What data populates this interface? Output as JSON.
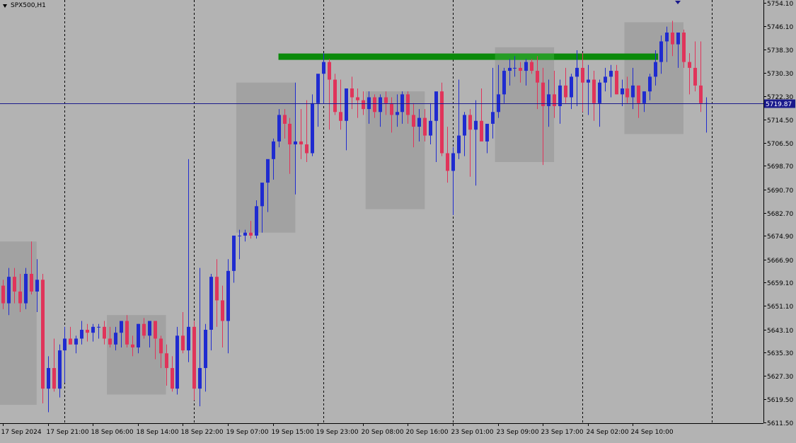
{
  "symbol": "SPX500,H1",
  "colors": {
    "background": "#b3b3b3",
    "bull": "#1f2bd0",
    "bear": "#e0345a",
    "zone": "#a2a2a2",
    "resistance": "#0a8a0a",
    "resistance_light": "#2aa02a",
    "price_line": "#1a1a8c",
    "grid": "#000000",
    "marker": "#1a1a8c"
  },
  "chart_data": {
    "type": "candlestick",
    "title": "SPX500,H1",
    "current_price": "5719.87",
    "ylim": [
      5611.5,
      5754.1
    ],
    "y_ticks": [
      "5754.10",
      "5746.10",
      "5738.30",
      "5730.30",
      "5722.30",
      "5714.50",
      "5706.50",
      "5698.70",
      "5690.70",
      "5682.70",
      "5674.90",
      "5666.90",
      "5659.10",
      "5651.10",
      "5643.10",
      "5635.30",
      "5627.30",
      "5619.50",
      "5611.50"
    ],
    "x_ticks": [
      {
        "bar": 0,
        "label": "17 Sep 2024"
      },
      {
        "bar": 8,
        "label": "17 Sep 21:00"
      },
      {
        "bar": 16,
        "label": "18 Sep 06:00"
      },
      {
        "bar": 24,
        "label": "18 Sep 14:00"
      },
      {
        "bar": 32,
        "label": "18 Sep 22:00"
      },
      {
        "bar": 40,
        "label": "19 Sep 07:00"
      },
      {
        "bar": 48,
        "label": "19 Sep 15:00"
      },
      {
        "bar": 56,
        "label": "19 Sep 23:00"
      },
      {
        "bar": 64,
        "label": "20 Sep 08:00"
      },
      {
        "bar": 72,
        "label": "20 Sep 16:00"
      },
      {
        "bar": 80,
        "label": "23 Sep 01:00"
      },
      {
        "bar": 88,
        "label": "23 Sep 09:00"
      },
      {
        "bar": 96,
        "label": "23 Sep 17:00"
      },
      {
        "bar": 104,
        "label": "24 Sep 02:00"
      },
      {
        "bar": 112,
        "label": "24 Sep 10:00"
      }
    ],
    "separators": [
      11,
      34,
      57,
      80,
      103,
      126
    ],
    "zones": [
      {
        "from": 0,
        "to": 5.5,
        "high": 5673.0,
        "low": 5617.5
      },
      {
        "from": 19,
        "to": 28.5,
        "high": 5648.0,
        "low": 5621.0
      },
      {
        "from": 42,
        "to": 51.5,
        "high": 5727.0,
        "low": 5676.0
      },
      {
        "from": 65,
        "to": 74.5,
        "high": 5724.0,
        "low": 5684.0
      },
      {
        "from": 88,
        "to": 97.5,
        "high": 5739.0,
        "low": 5700.0
      },
      {
        "from": 111,
        "to": 120.5,
        "high": 5747.5,
        "low": 5709.5
      }
    ],
    "resistance": {
      "from": 49,
      "to": 116.5,
      "value": 5735.8
    },
    "resistance_highlight": {
      "from": 88,
      "to": 97.5
    },
    "candles": [
      [
        5658,
        5660,
        5650,
        5652
      ],
      [
        5652,
        5664,
        5648,
        5661
      ],
      [
        5661,
        5664,
        5652,
        5656
      ],
      [
        5656,
        5662,
        5649,
        5652
      ],
      [
        5652,
        5664,
        5650,
        5662
      ],
      [
        5662,
        5673,
        5655,
        5656
      ],
      [
        5656,
        5667,
        5649,
        5660
      ],
      [
        5660,
        5662,
        5618,
        5623
      ],
      [
        5623,
        5634,
        5615,
        5630
      ],
      [
        5630,
        5640,
        5622,
        5623
      ],
      [
        5623,
        5638,
        5620,
        5636
      ],
      [
        5636,
        5644,
        5625,
        5640
      ],
      [
        5640,
        5644,
        5638,
        5638
      ],
      [
        5638,
        5641,
        5635,
        5640
      ],
      [
        5640,
        5646,
        5638,
        5643
      ],
      [
        5643,
        5645,
        5639,
        5642
      ],
      [
        5642,
        5645,
        5639,
        5644
      ],
      [
        5644,
        5645,
        5640,
        5644
      ],
      [
        5644,
        5646,
        5638,
        5640
      ],
      [
        5640,
        5644,
        5637,
        5638
      ],
      [
        5638,
        5644,
        5636,
        5642
      ],
      [
        5642,
        5646,
        5637,
        5646
      ],
      [
        5646,
        5648,
        5637,
        5638
      ],
      [
        5638,
        5641,
        5634,
        5637
      ],
      [
        5637,
        5645,
        5635,
        5645
      ],
      [
        5645,
        5647,
        5640,
        5641
      ],
      [
        5641,
        5646,
        5637,
        5646
      ],
      [
        5646,
        5646,
        5633,
        5640
      ],
      [
        5640,
        5641,
        5630,
        5635
      ],
      [
        5635,
        5638,
        5624,
        5630
      ],
      [
        5630,
        5634,
        5622,
        5623
      ],
      [
        5623,
        5644,
        5621,
        5641
      ],
      [
        5641,
        5649,
        5635,
        5636
      ],
      [
        5636,
        5701,
        5632,
        5644
      ],
      [
        5644,
        5646,
        5619,
        5623
      ],
      [
        5623,
        5664,
        5617,
        5630
      ],
      [
        5630,
        5645,
        5622,
        5643
      ],
      [
        5643,
        5662,
        5636,
        5661
      ],
      [
        5661,
        5667,
        5644,
        5653
      ],
      [
        5653,
        5658,
        5637,
        5646
      ],
      [
        5646,
        5667,
        5635,
        5663
      ],
      [
        5663,
        5674,
        5659,
        5675
      ],
      [
        5675,
        5677,
        5667,
        5675
      ],
      [
        5675,
        5677,
        5673,
        5676
      ],
      [
        5676,
        5680,
        5674,
        5675
      ],
      [
        5675,
        5687,
        5674,
        5685
      ],
      [
        5685,
        5690,
        5676,
        5693
      ],
      [
        5693,
        5698,
        5683,
        5701
      ],
      [
        5701,
        5708,
        5694,
        5707
      ],
      [
        5707,
        5718,
        5705,
        5716
      ],
      [
        5716,
        5718,
        5708,
        5713
      ],
      [
        5713,
        5715,
        5696,
        5706
      ],
      [
        5706,
        5727,
        5689,
        5707
      ],
      [
        5707,
        5718,
        5701,
        5706
      ],
      [
        5706,
        5721,
        5700,
        5703
      ],
      [
        5703,
        5723,
        5702,
        5720
      ],
      [
        5720,
        5727,
        5712,
        5730
      ],
      [
        5730,
        5737,
        5720,
        5734
      ],
      [
        5734,
        5735,
        5711,
        5728
      ],
      [
        5728,
        5730,
        5716,
        5717
      ],
      [
        5717,
        5728,
        5711,
        5714
      ],
      [
        5714,
        5722,
        5704,
        5725
      ],
      [
        5725,
        5729,
        5718,
        5722
      ],
      [
        5722,
        5725,
        5715,
        5721
      ],
      [
        5721,
        5724,
        5716,
        5718
      ],
      [
        5718,
        5724,
        5713,
        5722
      ],
      [
        5722,
        5723,
        5715,
        5717
      ],
      [
        5717,
        5723,
        5712,
        5722
      ],
      [
        5722,
        5724,
        5716,
        5720
      ],
      [
        5720,
        5722,
        5710,
        5716
      ],
      [
        5716,
        5723,
        5712,
        5717
      ],
      [
        5717,
        5724,
        5713,
        5723
      ],
      [
        5723,
        5724,
        5713,
        5716
      ],
      [
        5716,
        5720,
        5705,
        5712
      ],
      [
        5712,
        5718,
        5707,
        5715
      ],
      [
        5715,
        5718,
        5707,
        5709
      ],
      [
        5709,
        5720,
        5706,
        5714
      ],
      [
        5714,
        5723,
        5700,
        5724
      ],
      [
        5724,
        5727,
        5702,
        5703
      ],
      [
        5703,
        5712,
        5693,
        5697
      ],
      [
        5697,
        5705,
        5682,
        5703
      ],
      [
        5703,
        5728,
        5701,
        5709
      ],
      [
        5709,
        5717,
        5702,
        5716
      ],
      [
        5716,
        5718,
        5695,
        5711
      ],
      [
        5711,
        5721,
        5692,
        5714
      ],
      [
        5714,
        5725,
        5708,
        5707
      ],
      [
        5707,
        5710,
        5703,
        5713
      ],
      [
        5713,
        5732,
        5708,
        5717
      ],
      [
        5717,
        5733,
        5715,
        5723
      ],
      [
        5723,
        5732,
        5720,
        5731
      ],
      [
        5731,
        5735,
        5726,
        5732
      ],
      [
        5732,
        5736,
        5729,
        5732
      ],
      [
        5732,
        5734,
        5727,
        5731
      ],
      [
        5731,
        5735,
        5726,
        5734
      ],
      [
        5734,
        5735,
        5730,
        5731
      ],
      [
        5731,
        5736,
        5718,
        5727
      ],
      [
        5727,
        5732,
        5699,
        5719
      ],
      [
        5719,
        5728,
        5712,
        5723
      ],
      [
        5723,
        5731,
        5715,
        5719
      ],
      [
        5719,
        5728,
        5713,
        5726
      ],
      [
        5726,
        5732,
        5720,
        5722
      ],
      [
        5722,
        5730,
        5718,
        5729
      ],
      [
        5729,
        5738,
        5719,
        5732
      ],
      [
        5732,
        5737,
        5717,
        5727
      ],
      [
        5727,
        5733,
        5716,
        5728
      ],
      [
        5728,
        5731,
        5714,
        5720
      ],
      [
        5720,
        5728,
        5712,
        5727
      ],
      [
        5727,
        5732,
        5724,
        5729
      ],
      [
        5729,
        5733,
        5722,
        5731
      ],
      [
        5731,
        5733,
        5723,
        5723
      ],
      [
        5723,
        5728,
        5719,
        5725
      ],
      [
        5725,
        5729,
        5720,
        5722
      ],
      [
        5722,
        5732,
        5718,
        5726
      ],
      [
        5726,
        5726,
        5715,
        5720
      ],
      [
        5720,
        5724,
        5717,
        5724
      ],
      [
        5724,
        5730,
        5721,
        5729
      ],
      [
        5729,
        5738,
        5726,
        5734
      ],
      [
        5734,
        5743,
        5730,
        5741
      ],
      [
        5741,
        5746,
        5734,
        5744
      ],
      [
        5744,
        5748,
        5736,
        5740
      ],
      [
        5740,
        5741,
        5732,
        5744
      ],
      [
        5744,
        5745,
        5732,
        5734
      ],
      [
        5734,
        5737,
        5723,
        5732
      ],
      [
        5732,
        5741,
        5724,
        5726
      ],
      [
        5726,
        5741,
        5717,
        5720
      ],
      [
        5720,
        5722,
        5710,
        5720
      ]
    ]
  }
}
